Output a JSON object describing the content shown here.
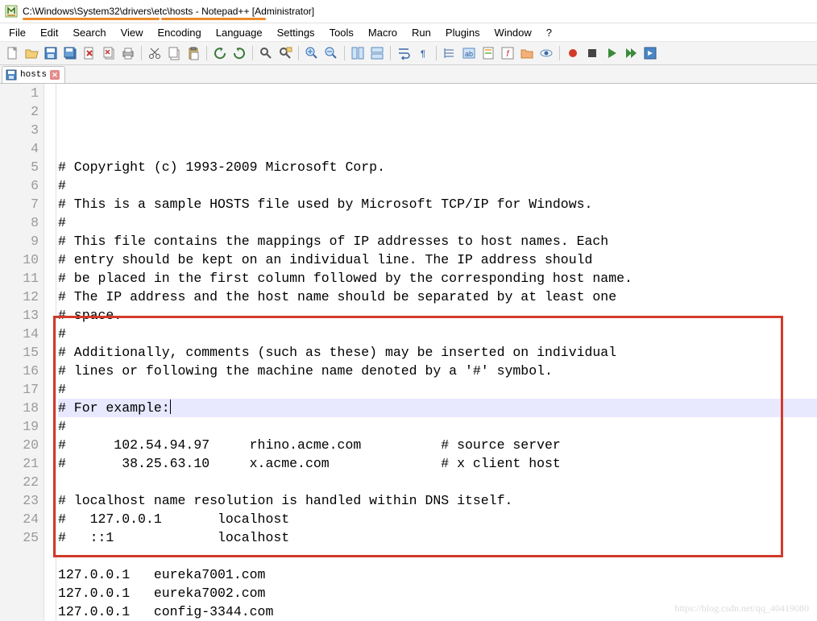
{
  "window": {
    "title": "C:\\Windows\\System32\\drivers\\etc\\hosts - Notepad++ [Administrator]"
  },
  "menu": [
    "File",
    "Edit",
    "Search",
    "View",
    "Encoding",
    "Language",
    "Settings",
    "Tools",
    "Macro",
    "Run",
    "Plugins",
    "Window",
    "?"
  ],
  "toolbar_icons": [
    "new-file-icon",
    "open-file-icon",
    "save-icon",
    "save-all-icon",
    "close-icon",
    "close-all-icon",
    "print-icon",
    "sep",
    "cut-icon",
    "copy-icon",
    "paste-icon",
    "sep",
    "undo-icon",
    "redo-icon",
    "sep",
    "find-icon",
    "replace-icon",
    "sep",
    "zoom-in-icon",
    "zoom-out-icon",
    "sep",
    "sync-v-icon",
    "sync-h-icon",
    "sep",
    "wordwrap-icon",
    "show-all-icon",
    "sep",
    "indent-guide-icon",
    "lang-icon",
    "doc-map-icon",
    "func-list-icon",
    "folder-icon",
    "monitor-icon",
    "sep",
    "record-icon",
    "stop-icon",
    "play-icon",
    "play-multi-icon",
    "save-macro-icon"
  ],
  "tab": {
    "label": "hosts"
  },
  "lines": [
    "# Copyright (c) 1993-2009 Microsoft Corp.",
    "#",
    "# This is a sample HOSTS file used by Microsoft TCP/IP for Windows.",
    "#",
    "# This file contains the mappings of IP addresses to host names. Each",
    "# entry should be kept on an individual line. The IP address should",
    "# be placed in the first column followed by the corresponding host name.",
    "# The IP address and the host name should be separated by at least one",
    "# space.",
    "#",
    "# Additionally, comments (such as these) may be inserted on individual",
    "# lines or following the machine name denoted by a '#' symbol.",
    "#",
    "# For example:",
    "#",
    "#      102.54.94.97     rhino.acme.com          # source server",
    "#       38.25.63.10     x.acme.com              # x client host",
    "",
    "# localhost name resolution is handled within DNS itself.",
    "#   127.0.0.1       localhost",
    "#   ::1             localhost",
    "",
    "127.0.0.1   eureka7001.com",
    "127.0.0.1   eureka7002.com",
    "127.0.0.1   config-3344.com"
  ],
  "highlight_line_index": 13,
  "watermark": "https://blog.csdn.net/qq_40419080"
}
